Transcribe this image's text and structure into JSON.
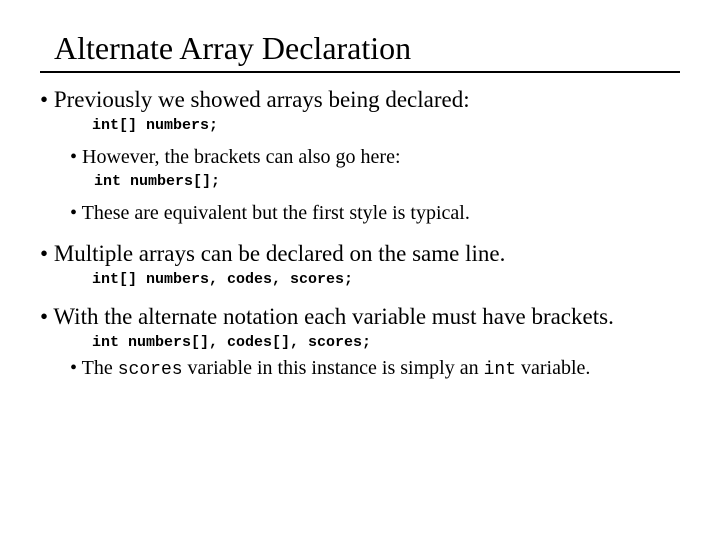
{
  "title": "Alternate Array Declaration",
  "b1": {
    "text": "Previously we showed arrays being declared:",
    "code": "int[] numbers;",
    "sub1": {
      "text": "However, the brackets can also go here:",
      "code": "int numbers[];"
    },
    "sub2": {
      "text": "These are equivalent but the first style is typical."
    }
  },
  "b2": {
    "text": "Multiple arrays can be declared on the same line.",
    "code": "int[] numbers, codes, scores;"
  },
  "b3": {
    "text": "With the alternate notation each variable must have brackets.",
    "code": "int numbers[], codes[], scores;",
    "note_pre": "The ",
    "note_code1": "scores",
    "note_mid": " variable in this instance is simply an ",
    "note_code2": "int",
    "note_post": " variable."
  }
}
